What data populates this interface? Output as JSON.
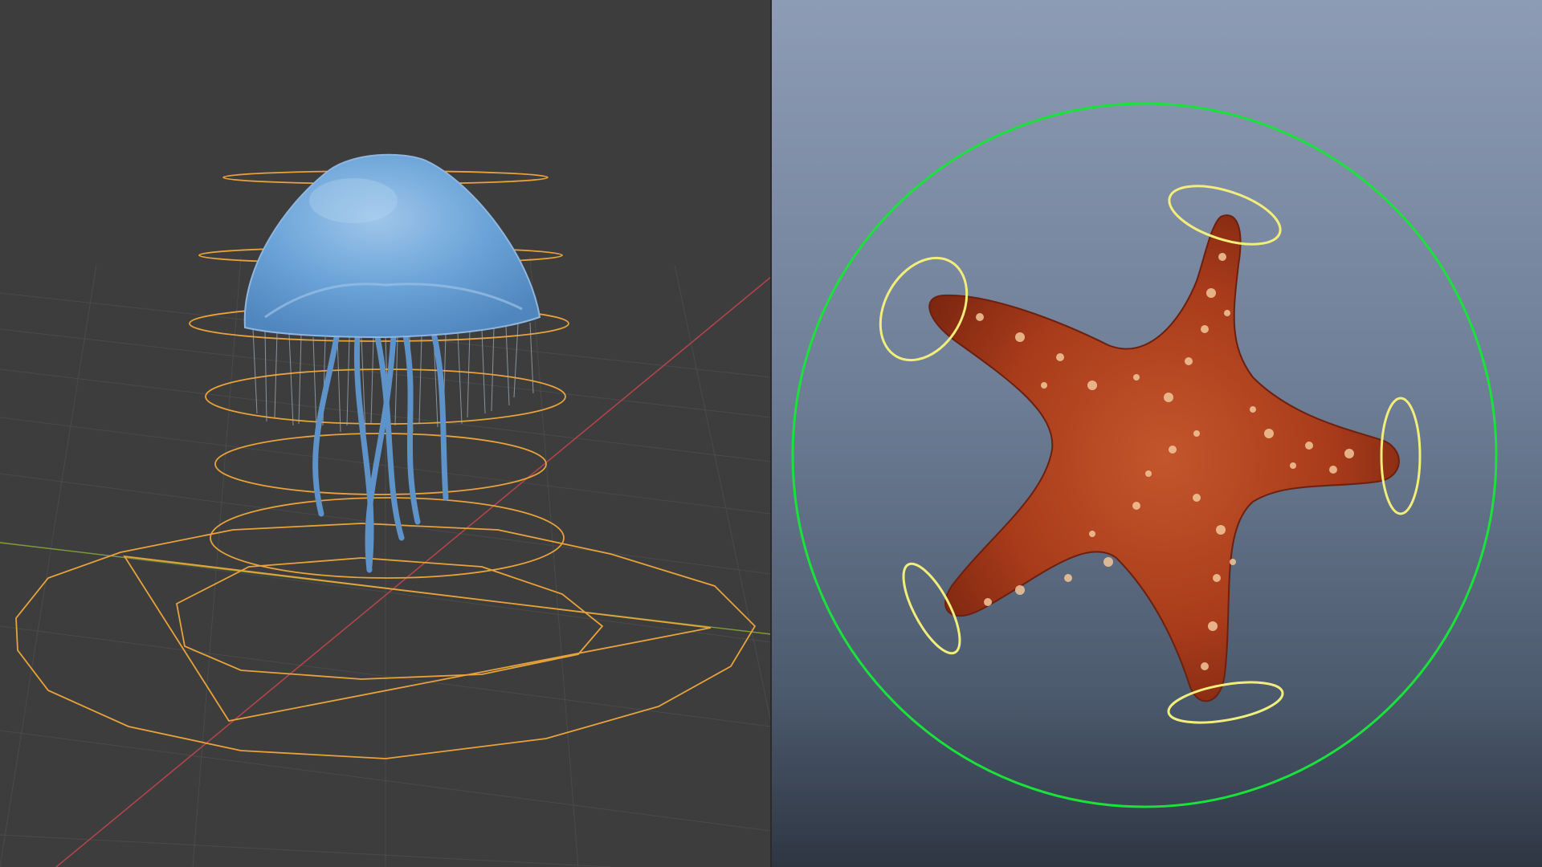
{
  "left_viewport": {
    "background": "#3d3d3d",
    "grid_color": "#4a4a4a",
    "x_axis_color": "#b0444a",
    "y_axis_color": "#7e9b3c",
    "control_color": "#e8a23a",
    "subject": "jellyfish-model",
    "subject_color": "#6aa3d8"
  },
  "right_viewport": {
    "background_top": "#8d9cb4",
    "background_bottom": "#2e3642",
    "root_control_color": "#19e33a",
    "limb_control_color": "#f2ee7c",
    "subject": "starfish-model",
    "subject_color": "#b5421f",
    "spot_color": "#f3c79a"
  }
}
